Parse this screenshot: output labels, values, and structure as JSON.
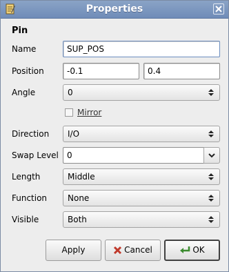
{
  "window": {
    "title": "Properties",
    "icon": "notepad-icon",
    "close_icon": "close-icon"
  },
  "section": {
    "title": "Pin"
  },
  "fields": {
    "name": {
      "label": "Name",
      "value": "SUP_POS"
    },
    "position": {
      "label": "Position",
      "x": "-0.1",
      "y": "0.4"
    },
    "angle": {
      "label": "Angle",
      "value": "0"
    },
    "mirror": {
      "label": "Mirror",
      "checked": false
    },
    "direction": {
      "label": "Direction",
      "value": "I/O"
    },
    "swap_level": {
      "label": "Swap Level",
      "value": "0"
    },
    "length": {
      "label": "Length",
      "value": "Middle"
    },
    "function": {
      "label": "Function",
      "value": "None"
    },
    "visible": {
      "label": "Visible",
      "value": "Both"
    }
  },
  "buttons": {
    "apply": "Apply",
    "cancel": "Cancel",
    "ok": "OK"
  },
  "colors": {
    "titlebar": "#7a95be",
    "window_bg": "#ededed",
    "cancel_icon": "#c0392b",
    "ok_icon": "#3a8a2e"
  }
}
